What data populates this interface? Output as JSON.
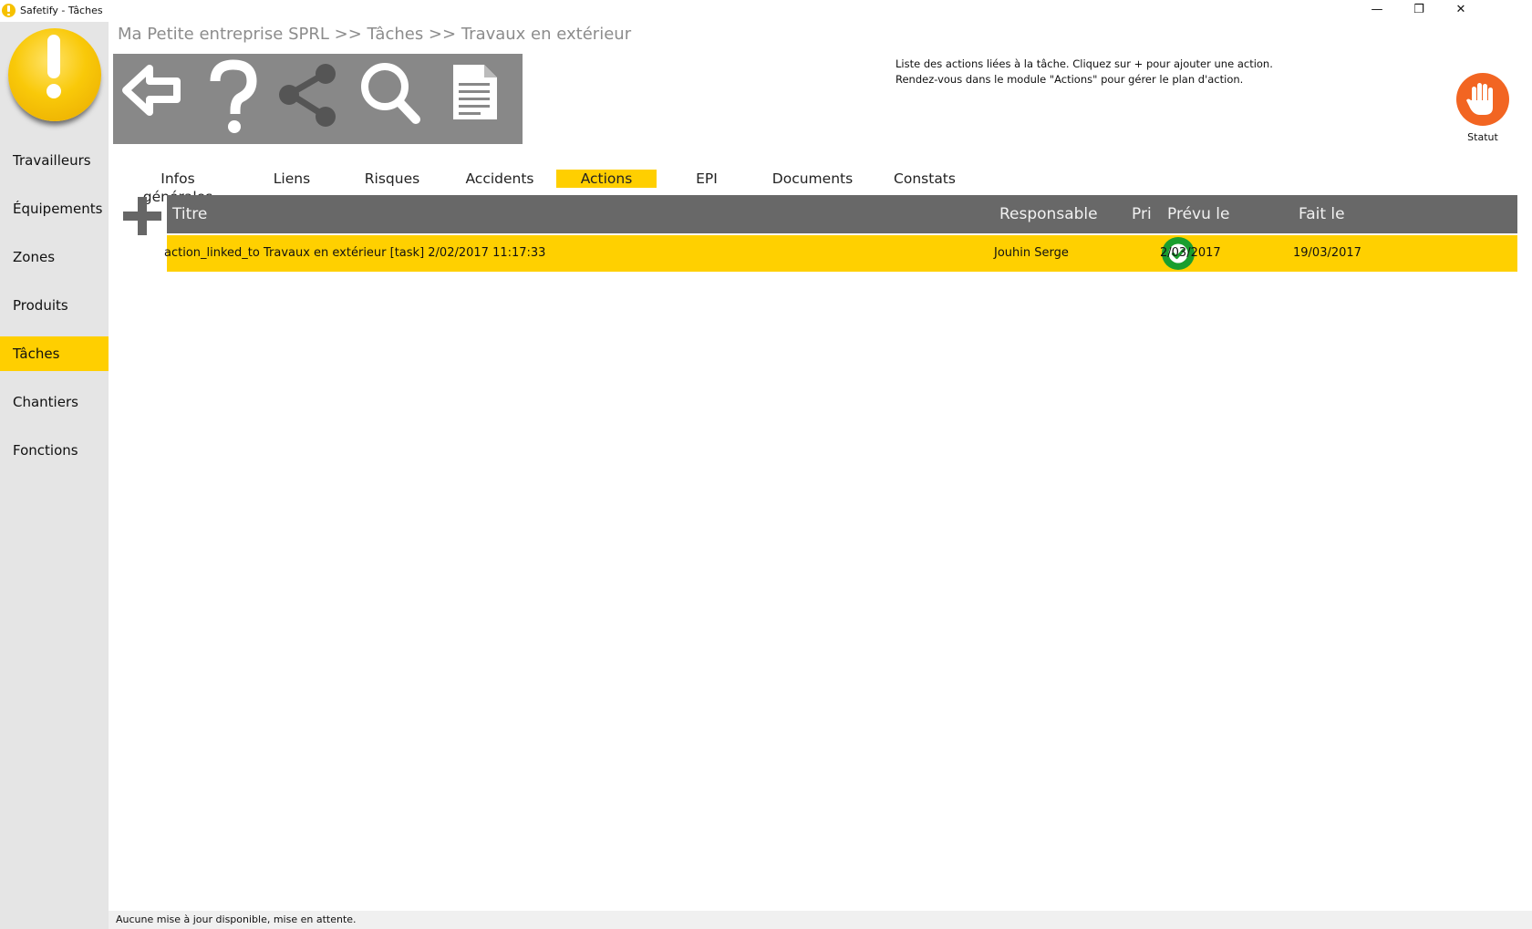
{
  "window": {
    "title": "Safetify - Tâches",
    "minimize_glyph": "—",
    "restore_glyph": "❐",
    "close_glyph": "✕"
  },
  "breadcrumb": "Ma Petite entreprise SPRL >> Tâches >> Travaux en extérieur",
  "toolbar": {
    "icons": [
      "back-arrow-icon",
      "help-icon",
      "share-icon",
      "search-icon",
      "document-icon"
    ]
  },
  "sidebar": {
    "items": [
      {
        "label": "Travailleurs",
        "active": false
      },
      {
        "label": "Équipements",
        "active": false
      },
      {
        "label": "Zones",
        "active": false
      },
      {
        "label": "Produits",
        "active": false
      },
      {
        "label": "Tâches",
        "active": true
      },
      {
        "label": "Chantiers",
        "active": false
      },
      {
        "label": "Fonctions",
        "active": false
      }
    ]
  },
  "info": {
    "line1": "Liste des actions liées à la tâche. Cliquez sur + pour ajouter une action.",
    "line2": "Rendez-vous dans le module \"Actions\" pour gérer le plan d'action."
  },
  "status": {
    "label": "Statut",
    "icon": "stop-hand-icon",
    "color": "#f26522"
  },
  "tabs": [
    {
      "label": "Infos générales",
      "active": false
    },
    {
      "label": "Liens",
      "active": false
    },
    {
      "label": "Risques",
      "active": false
    },
    {
      "label": "Accidents",
      "active": false
    },
    {
      "label": "Actions",
      "active": true
    },
    {
      "label": "EPI",
      "active": false
    },
    {
      "label": "Documents",
      "active": false
    },
    {
      "label": "Constats",
      "active": false
    }
  ],
  "table": {
    "columns": [
      "Titre",
      "Responsable",
      "Pri",
      "Prévu le",
      "Fait le"
    ],
    "rows": [
      {
        "titre": "action_linked_to Travaux en extérieur [task]  2/02/2017 11:17:33",
        "responsable": "Jouhin Serge",
        "priority_icon": "check-circle-icon",
        "prevu_le": "2/03/2017",
        "fait_le": "19/03/2017"
      }
    ]
  },
  "colors": {
    "accent": "#ffcf00",
    "toolbar": "#888888",
    "table_header": "#686868",
    "sidebar": "#e5e5e5",
    "priority_ok": "#1a9e2e"
  },
  "status_bar": "Aucune mise à jour disponible, mise en attente."
}
